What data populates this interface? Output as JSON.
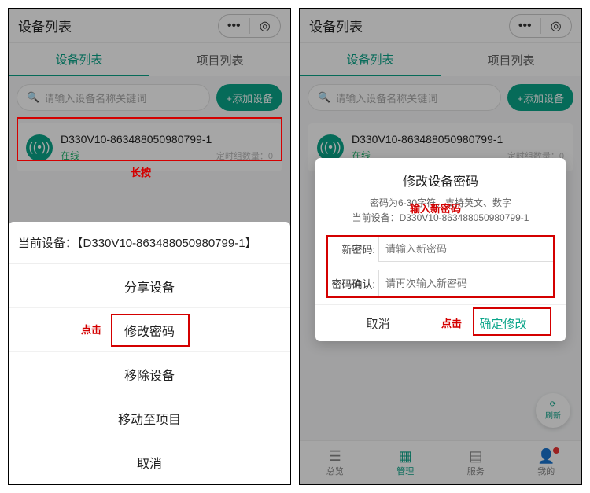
{
  "header": {
    "title": "设备列表"
  },
  "tabs": {
    "devices": "设备列表",
    "projects": "项目列表"
  },
  "search": {
    "placeholder": "请输入设备名称关键词"
  },
  "add": {
    "label": "+添加设备"
  },
  "device": {
    "name": "D330V10-863488050980799-1",
    "status": "在线",
    "meta": "定时组数量：0"
  },
  "ann": {
    "longpress": "长按",
    "click": "点击",
    "input_new": "输入新密码"
  },
  "sheet": {
    "header_prefix": "当前设备：【",
    "header_suffix": "】",
    "share": "分享设备",
    "modify_pwd": "修改密码",
    "remove": "移除设备",
    "move": "移动至项目",
    "cancel": "取消"
  },
  "modal": {
    "title": "修改设备密码",
    "hint": "密码为6-30字符，支持英文、数字",
    "device_prefix": "当前设备：",
    "new_pwd": "新密码:",
    "confirm_pwd": "密码确认:",
    "ph_new": "请输入新密码",
    "ph_confirm": "请再次输入新密码",
    "cancel": "取消",
    "ok": "确定修改"
  },
  "fab": {
    "refresh": "刷新"
  },
  "bottom": {
    "overview": "总览",
    "manage": "管理",
    "service": "服务",
    "mine": "我的"
  }
}
